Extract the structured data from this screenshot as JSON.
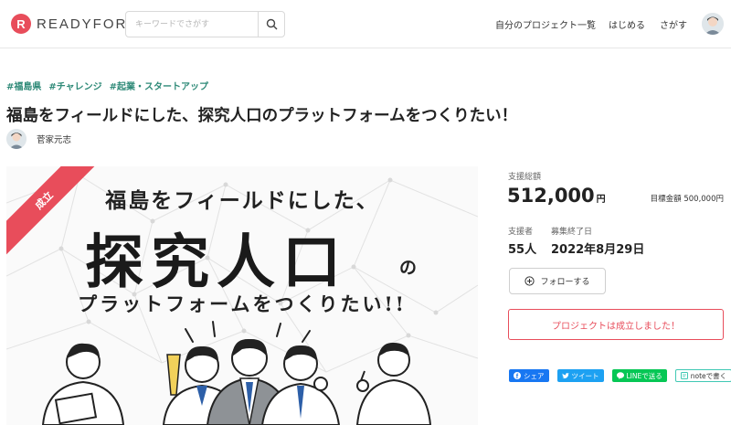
{
  "header": {
    "logo_mark": "R",
    "logo_text": "READYFOR",
    "search_placeholder": "キーワードでさがす",
    "nav": [
      "自分のプロジェクト一覧",
      "はじめる",
      "さがす"
    ]
  },
  "project": {
    "tags": [
      "#福島県",
      "#チャレンジ",
      "#起業・スタートアップ"
    ],
    "title": "福島をフィールドにした、探究人口のプラットフォームをつくりたい！",
    "owner": "菅家元志"
  },
  "hero": {
    "badge": "成立",
    "line1": "福島をフィールドにした、",
    "big": "探究人口",
    "no": "の",
    "line3": "プラットフォームをつくりたい!!"
  },
  "stats": {
    "total_label": "支援総額",
    "total_value": "512,000",
    "total_unit": "円",
    "goal": "目標金額 500,000円",
    "supporters_label": "支援者",
    "supporters_value": "55人",
    "end_label": "募集終了日",
    "end_value": "2022年8月29日"
  },
  "actions": {
    "follow": "フォローする",
    "success": "プロジェクトは成立しました！"
  },
  "share": {
    "facebook": "シェア",
    "twitter": "ツイート",
    "line": "LINEで送る",
    "note": "noteで書く"
  },
  "colors": {
    "brand": "#e84d5b",
    "tag": "#2f8a78"
  }
}
